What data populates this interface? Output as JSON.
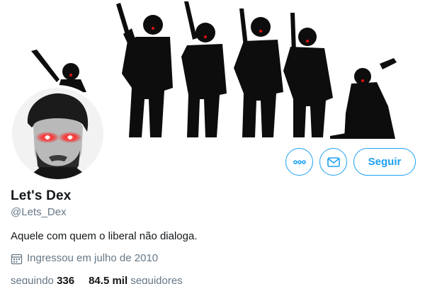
{
  "profile": {
    "display_name": "Let's Dex",
    "handle": "@Lets_Dex",
    "bio": "Aquele com quem o liberal não dialoga.",
    "joined": "Ingressou em julho de 2010",
    "following_label": "seguindo",
    "following_count": "336",
    "followers_count": "84,5 mil",
    "followers_label": "seguidores"
  },
  "actions": {
    "follow_label": "Seguir"
  },
  "icons": {
    "more": "more-dots-icon",
    "message": "envelope-icon",
    "calendar": "calendar-icon"
  },
  "colors": {
    "accent": "#1da1f2",
    "muted": "#657786",
    "text": "#14171a",
    "eye_glow": "#ff1a1a"
  }
}
